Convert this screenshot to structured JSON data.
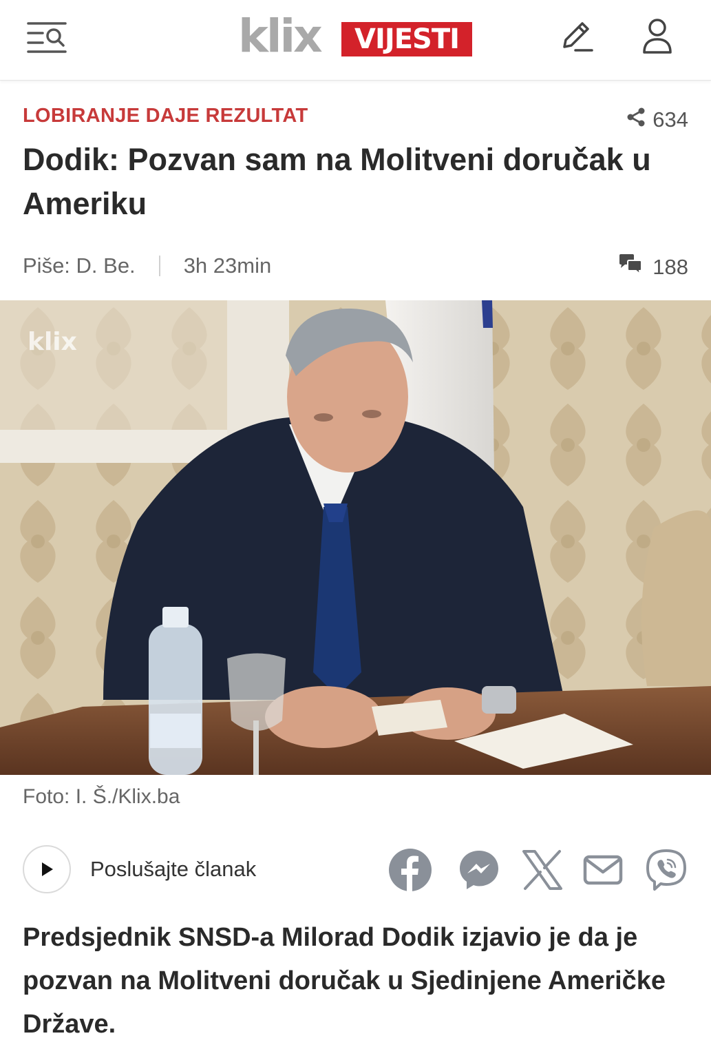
{
  "header": {
    "logo_text": "klix",
    "logo_badge": "VIJESTI",
    "menu_icon": "menu-search-icon",
    "edit_icon": "pencil-icon",
    "user_icon": "user-icon"
  },
  "article": {
    "category": "LOBIRANJE DAJE REZULTAT",
    "share_count": "634",
    "title": "Dodik: Pozvan sam na Molitveni doručak u Ameriku",
    "author": "Piše: D. Be.",
    "time_ago": "3h 23min",
    "comment_count": "188",
    "photo_watermark": "klix",
    "photo_caption": "Foto: I. Š./Klix.ba",
    "listen_label": "Poslušajte članak",
    "lead": "Predsjednik SNSD-a Milorad Dodik izjavio je da je pozvan na Molitveni doručak u Sjedinjene Američke Države."
  },
  "share_buttons": [
    "facebook-icon",
    "messenger-icon",
    "x-icon",
    "email-icon",
    "viber-icon"
  ],
  "colors": {
    "brand_red": "#d3222a",
    "category_red": "#c73a3a",
    "icon_gray": "#8a9099",
    "text_dark": "#2a2a2a"
  }
}
